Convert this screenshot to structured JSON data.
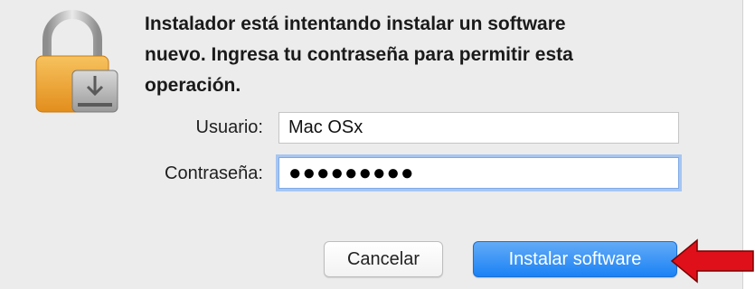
{
  "dialog": {
    "message_lines": [
      "Instalador está intentando instalar un software",
      "nuevo. Ingresa tu contraseña para permitir esta",
      "operación."
    ],
    "icon": "lock-installer-icon"
  },
  "form": {
    "username_label": "Usuario:",
    "username_value": "Mac OSx",
    "password_label": "Contraseña:",
    "password_value": "●●●●●●●●●"
  },
  "buttons": {
    "cancel_label": "Cancelar",
    "install_label": "Instalar software"
  },
  "annotation": {
    "icon": "red-arrow-pointer",
    "color": "#e0101a"
  },
  "colors": {
    "dialog_bg": "#ececec",
    "primary_button": "#1a82f5",
    "focus_ring": "#a6c6f2"
  }
}
